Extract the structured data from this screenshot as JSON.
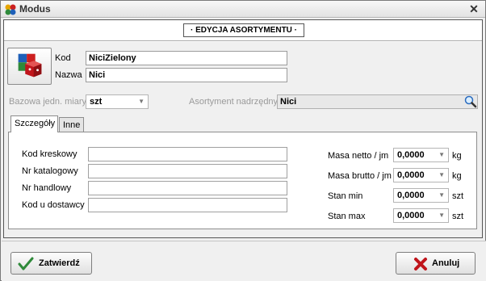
{
  "window": {
    "title": "Modus",
    "close_glyph": "✕"
  },
  "header": {
    "section_title": "· EDYCJA ASORTYMENTU ·"
  },
  "identity": {
    "kod_label": "Kod",
    "kod_value": "NiciZielony",
    "nazwa_label": "Nazwa",
    "nazwa_value": "Nici"
  },
  "base_unit": {
    "label": "Bazowa jedn. miary",
    "value": "szt"
  },
  "parent": {
    "label": "Asortyment nadrzędny",
    "value": "Nici"
  },
  "tabs": [
    {
      "label": "Szczegóły"
    },
    {
      "label": "Inne"
    }
  ],
  "details": {
    "left_fields": [
      {
        "label": "Kod kreskowy",
        "value": ""
      },
      {
        "label": "Nr katalogowy",
        "value": ""
      },
      {
        "label": "Nr handlowy",
        "value": ""
      },
      {
        "label": "Kod u dostawcy",
        "value": ""
      }
    ],
    "right_fields": [
      {
        "label": "Masa netto / jm",
        "value": "0,0000",
        "unit": "kg"
      },
      {
        "label": "Masa brutto / jm",
        "value": "0,0000",
        "unit": "kg"
      },
      {
        "label": "Stan min",
        "value": "0,0000",
        "unit": "szt"
      },
      {
        "label": "Stan max",
        "value": "0,0000",
        "unit": "szt"
      }
    ]
  },
  "footer": {
    "confirm_label": "Zatwierdź",
    "cancel_label": "Anuluj"
  },
  "icons": {
    "app": "modus-app-icon",
    "item": "product-boxes-icon",
    "search": "magnifier-icon",
    "confirm": "check-icon",
    "cancel": "red-x-icon"
  },
  "colors": {
    "accent_red": "#c0151b",
    "accent_green": "#2f8a3a"
  }
}
